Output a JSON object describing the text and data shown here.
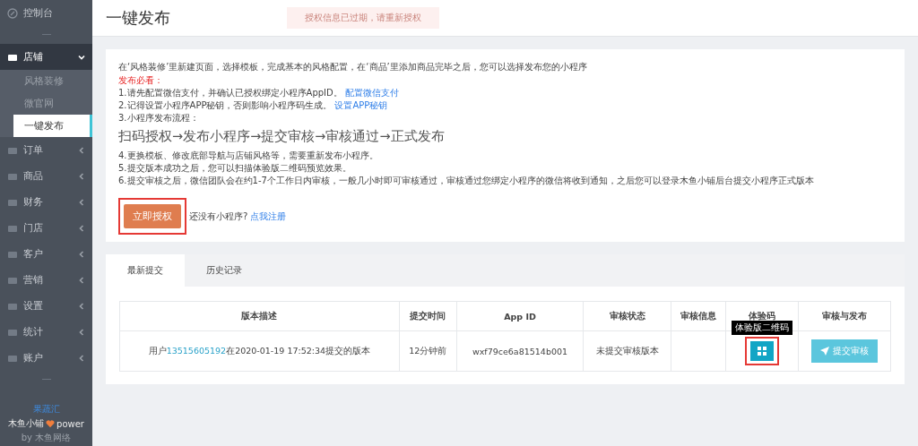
{
  "sidebar": {
    "items": [
      {
        "kind": "link",
        "label": "控制台"
      },
      {
        "kind": "divider"
      },
      {
        "kind": "group",
        "label": "店铺",
        "expanded": true,
        "children": [
          {
            "label": "风格装修",
            "selected": false
          },
          {
            "label": "微官网",
            "selected": false
          },
          {
            "label": "一键发布",
            "selected": true
          }
        ]
      },
      {
        "kind": "group",
        "label": "订单",
        "expanded": false
      },
      {
        "kind": "group",
        "label": "商品",
        "expanded": false
      },
      {
        "kind": "group",
        "label": "财务",
        "expanded": false
      },
      {
        "kind": "group",
        "label": "门店",
        "expanded": false
      },
      {
        "kind": "group",
        "label": "客户",
        "expanded": false
      },
      {
        "kind": "group",
        "label": "营销",
        "expanded": false
      },
      {
        "kind": "group",
        "label": "设置",
        "expanded": false
      },
      {
        "kind": "group",
        "label": "统计",
        "expanded": false
      },
      {
        "kind": "group",
        "label": "账户",
        "expanded": false
      },
      {
        "kind": "divider"
      }
    ],
    "footer": {
      "brand": "果蔬汇",
      "name": "木鱼小铺",
      "power": "power",
      "by": "by 木鱼网络"
    }
  },
  "page": {
    "title": "一键发布",
    "alert": "授权信息已过期，请重新授权"
  },
  "intro": {
    "lead": "在‘风格装修’里新建页面，选择模板，完成基本的风格配置，在‘商品’里添加商品完毕之后，您可以选择发布您的小程序",
    "must_read": "发布必看：",
    "steps": [
      {
        "text": "1.请先配置微信支付，并确认已授权绑定小程序AppID。",
        "link": "配置微信支付"
      },
      {
        "text": "2.记得设置小程序APP秘钥，否则影响小程序码生成。",
        "link": "设置APP秘钥"
      },
      {
        "text": "3.小程序发布流程："
      }
    ],
    "flow": "扫码授权→发布小程序→提交审核→审核通过→正式发布",
    "notes": [
      "4.更换模板、修改底部导航与店铺风格等，需要重新发布小程序。",
      "5.提交版本成功之后，您可以扫描体验版二维码预览效果。",
      "6.提交审核之后，微信团队会在约1-7个工作日内审核，一般几小时即可审核通过，审核通过您绑定小程序的微信将收到通知，之后您可以登录木鱼小铺后台提交小程序正式版本"
    ],
    "authorize_button": "立即授权",
    "no_app": "还没有小程序?",
    "register_link": "点我注册"
  },
  "tabs": [
    {
      "label": "最新提交",
      "selected": true
    },
    {
      "label": "历史记录",
      "selected": false
    }
  ],
  "table": {
    "columns": [
      "版本描述",
      "提交时间",
      "App ID",
      "审核状态",
      "审核信息",
      "体验码",
      "审核与发布"
    ],
    "rows": [
      {
        "description": {
          "prefix": "用户",
          "user": "13515605192",
          "suffix": "在2020-01-19 17:52:34提交的版本"
        },
        "time": "12分钟前",
        "app_id": "wxf79ce6a81514b001",
        "status": "未提交审核版本",
        "info": "",
        "tooltip": "体验版二维码",
        "submit": "提交审核"
      }
    ]
  }
}
